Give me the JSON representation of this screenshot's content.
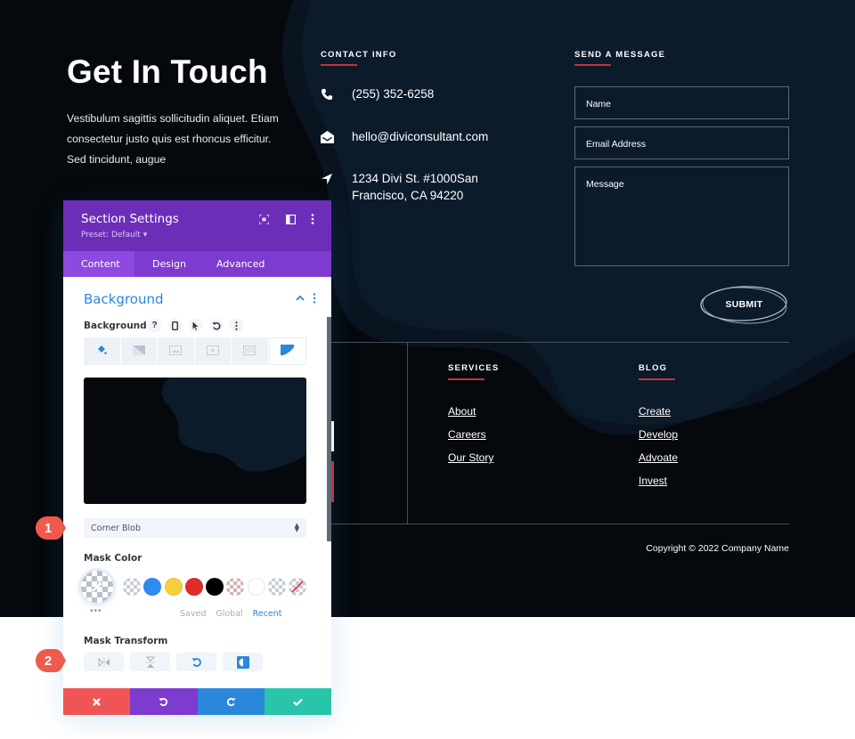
{
  "hero": {
    "title": "Get In Touch",
    "text": "Vestibulum sagittis sollicitudin aliquet. Etiam consectetur justo quis est rhoncus efficitur. Sed tincidunt, augue"
  },
  "contact": {
    "heading": "CONTACT INFO",
    "items": [
      {
        "icon": "phone-icon",
        "text": "(255) 352-6258"
      },
      {
        "icon": "envelope-open-icon",
        "text": "hello@diviconsultant.com"
      },
      {
        "icon": "location-arrow-icon",
        "text": "1234 Divi St. #1000San Francisco, CA 94220"
      }
    ]
  },
  "form": {
    "heading": "SEND A MESSAGE",
    "name_placeholder": "Name",
    "email_placeholder": "Email Address",
    "message_placeholder": "Message",
    "submit_label": "SUBMIT"
  },
  "footer": {
    "services": {
      "heading": "SERVICES",
      "links": [
        "About",
        "Careers",
        "Our Story"
      ]
    },
    "blog": {
      "heading": "BLOG",
      "links": [
        "Create",
        "Develop",
        "Advoate",
        "Invest"
      ]
    },
    "copyright": "Copyright © 2022 Company Name"
  },
  "colors": {
    "page_bg": "#05080c",
    "blob": "#0b1a28",
    "accent_red": "#c0343a",
    "panel_header": "#6c2eb9",
    "panel_tabs": "#7e3bd0",
    "divi_blue": "#2b87da"
  },
  "panel": {
    "title": "Section Settings",
    "preset": "Preset: Default ▾",
    "header_icons": [
      "expand-icon",
      "split-view-icon",
      "more-vertical-icon"
    ],
    "tabs": [
      {
        "label": "Content",
        "active": true
      },
      {
        "label": "Design",
        "active": false
      },
      {
        "label": "Advanced",
        "active": false
      }
    ],
    "section_title": "Background",
    "background_label": "Background",
    "background_tools": [
      "help-icon",
      "mobile-icon",
      "cursor-icon",
      "reset-icon",
      "more-icon"
    ],
    "background_types": [
      {
        "icon": "paint-bucket-icon",
        "active": false
      },
      {
        "icon": "gradient-icon",
        "active": false
      },
      {
        "icon": "image-icon",
        "active": false
      },
      {
        "icon": "video-icon",
        "active": false
      },
      {
        "icon": "pattern-icon",
        "active": false
      },
      {
        "icon": "mask-icon",
        "active": true
      }
    ],
    "mask_select": {
      "value": "Corner Blob"
    },
    "mask_color_label": "Mask Color",
    "swatches": [
      {
        "name": "transparent-checker",
        "color": "checker"
      },
      {
        "name": "blue",
        "color": "#2e8cf0"
      },
      {
        "name": "yellow",
        "color": "#f5d03a"
      },
      {
        "name": "red",
        "color": "#e02b2b"
      },
      {
        "name": "black",
        "color": "#000000"
      },
      {
        "name": "pink-checker",
        "color": "checker-red"
      },
      {
        "name": "white",
        "color": "#ffffff"
      },
      {
        "name": "light-checker",
        "color": "checker"
      },
      {
        "name": "none",
        "color": "none"
      }
    ],
    "palette_tabs": [
      {
        "label": "Saved",
        "active": false
      },
      {
        "label": "Global",
        "active": false
      },
      {
        "label": "Recent",
        "active": true
      }
    ],
    "mask_transform_label": "Mask Transform",
    "transform_buttons": [
      "flip-horizontal-icon",
      "flip-vertical-icon",
      "rotate-icon",
      "invert-icon"
    ],
    "footer_buttons": [
      {
        "name": "close",
        "icon": "close-icon",
        "color": "#ef5555"
      },
      {
        "name": "undo",
        "icon": "undo-icon",
        "color": "#7e3bd0"
      },
      {
        "name": "redo",
        "icon": "redo-icon",
        "color": "#2b87da"
      },
      {
        "name": "save",
        "icon": "check-icon",
        "color": "#29c4a9"
      }
    ]
  },
  "callouts": [
    "1",
    "2"
  ]
}
